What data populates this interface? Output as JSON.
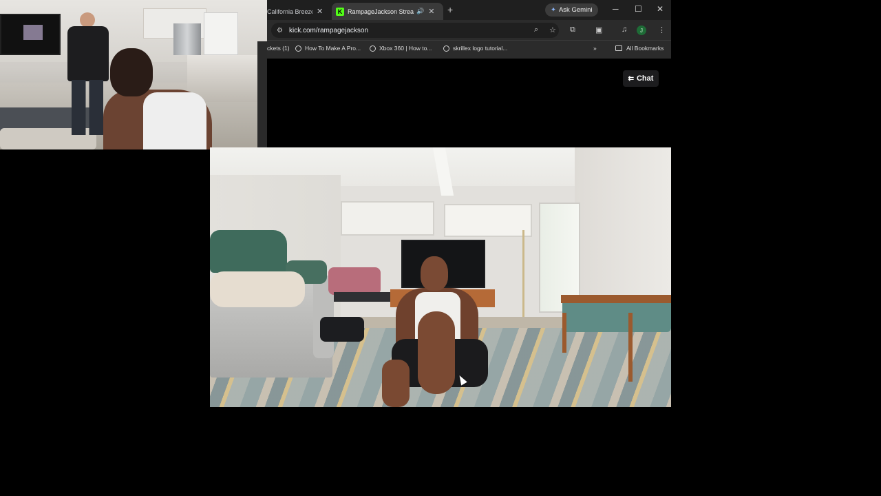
{
  "browser": {
    "tabs": [
      {
        "title": "California Breeze |",
        "active": false
      },
      {
        "title": "RampageJackson Stream - ",
        "active": true,
        "favicon": "K",
        "audio": "speaker-icon"
      }
    ],
    "ask_gemini": "Ask Gemini",
    "url": "kick.com/rampagejackson",
    "profile_initial": "J",
    "bookmarks": [
      "ckets (1)",
      "How To Make A Pro...",
      "Xbox 360 | How to...",
      "skrillex logo tutorial..."
    ],
    "all_bookmarks": "All Bookmarks"
  },
  "page": {
    "chat_label": "Chat"
  },
  "colors": {
    "kick_green": "#53fc18",
    "page_bg": "#000000",
    "browser_bg": "#2b2b2b",
    "tabbar_bg": "#1f1f1f"
  }
}
